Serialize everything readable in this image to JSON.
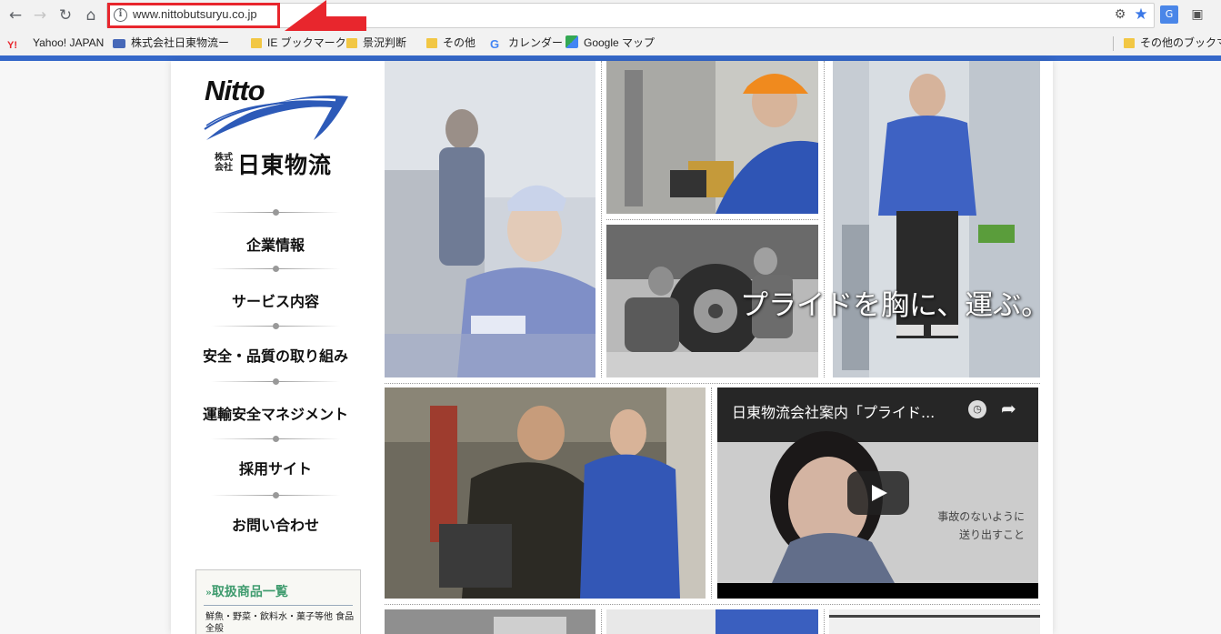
{
  "browser": {
    "url": "www.nittobutsuryu.co.jp",
    "bookmarks": [
      {
        "label": "Yahoo! JAPAN",
        "icon": "yahoo-icon"
      },
      {
        "label": "株式会社日東物流ー",
        "icon": "site-icon"
      },
      {
        "label": "IE ブックマーク",
        "icon": "folder-icon"
      },
      {
        "label": "景況判断",
        "icon": "folder-icon"
      },
      {
        "label": "その他",
        "icon": "folder-icon"
      },
      {
        "label": "カレンダー",
        "icon": "google-icon"
      },
      {
        "label": "Google マップ",
        "icon": "maps-icon"
      }
    ],
    "other_bookmarks": "その他のブックマー"
  },
  "logo": {
    "word": "Nitto",
    "kabushiki": "株式会社",
    "name": "日東物流"
  },
  "menu": [
    "企業情報",
    "サービス内容",
    "安全・品質の取り組み",
    "運輸安全マネジメント",
    "採用サイト",
    "お問い合わせ"
  ],
  "products": {
    "title": "取扱商品一覧",
    "text": "鮮魚・野菜・飲料水・菓子等他 食品全般"
  },
  "hero": {
    "tagline": "プライドを胸に、運ぶ。"
  },
  "video": {
    "title": "日東物流会社案内「プライド...",
    "caption_line1": "事故のないように",
    "caption_line2": "送り出すこと"
  },
  "colors": {
    "accent_blue": "#3568c9",
    "highlight_red": "#e8262d",
    "product_green": "#3f9b6e"
  }
}
